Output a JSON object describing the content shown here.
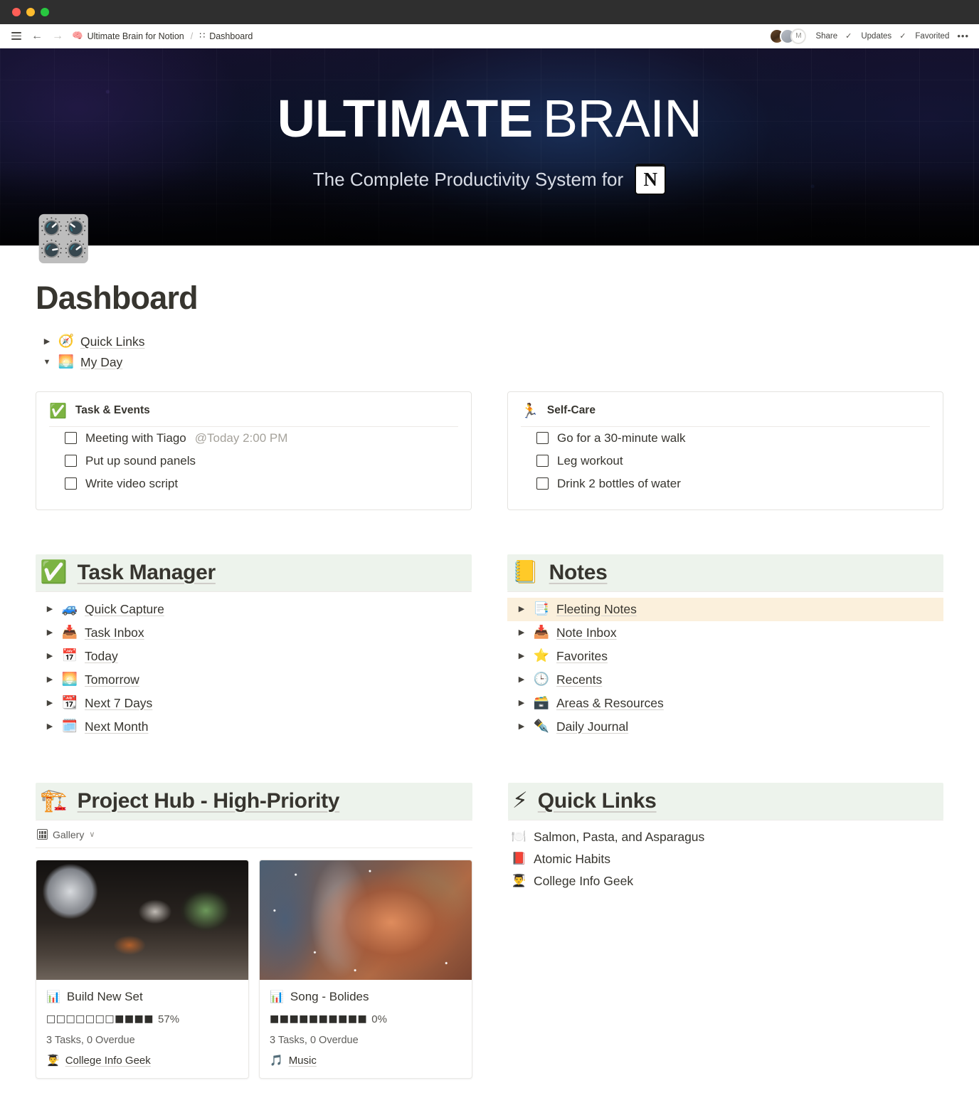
{
  "window": {
    "traffic_lights": [
      "close",
      "minimize",
      "maximize"
    ]
  },
  "topbar": {
    "menu_icon": "hamburger-icon",
    "back_icon": "arrow-left-icon",
    "forward_icon": "arrow-right-icon",
    "breadcrumb": {
      "parent_emoji": "🧠",
      "parent": "Ultimate Brain for Notion",
      "separator": "/",
      "current_emoji": "∷",
      "current": "Dashboard"
    },
    "avatars": [
      {
        "name": "avatar-1",
        "initial": ""
      },
      {
        "name": "avatar-2",
        "initial": ""
      },
      {
        "name": "avatar-3",
        "initial": "M"
      }
    ],
    "share_label": "Share",
    "updates_label": "Updates",
    "favorited_label": "Favorited",
    "check_glyph": "✓",
    "more_label": "•••"
  },
  "hero": {
    "title_bold": "ULTIMATE",
    "title_light": "BRAIN",
    "subtitle": "The Complete Productivity System for",
    "notion_logo_letter": "N"
  },
  "page": {
    "icon": "🎛️",
    "title": "Dashboard"
  },
  "toggles": [
    {
      "triangle": "▶",
      "emoji": "🧭",
      "label": "Quick Links"
    },
    {
      "triangle": "▼",
      "emoji": "🌅",
      "label": "My Day"
    }
  ],
  "my_day": {
    "tasks_card": {
      "emoji": "✅",
      "title": "Task & Events",
      "items": [
        {
          "text": "Meeting with Tiago ",
          "mention": "@Today 2:00 PM"
        },
        {
          "text": "Put up sound panels",
          "mention": ""
        },
        {
          "text": "Write video script",
          "mention": ""
        }
      ]
    },
    "selfcare_card": {
      "emoji": "🏃",
      "title": "Self-Care",
      "items": [
        {
          "text": "Go for a 30-minute walk",
          "mention": ""
        },
        {
          "text": "Leg workout",
          "mention": ""
        },
        {
          "text": "Drink 2 bottles of water",
          "mention": ""
        }
      ]
    }
  },
  "task_manager": {
    "emoji": "✅",
    "title": "Task Manager",
    "items": [
      {
        "triangle": "▶",
        "emoji": "🚙",
        "label": "Quick Capture",
        "highlight": false
      },
      {
        "triangle": "▶",
        "emoji": "📥",
        "label": "Task Inbox",
        "highlight": false
      },
      {
        "triangle": "▶",
        "emoji": "📅",
        "label": "Today",
        "highlight": false
      },
      {
        "triangle": "▶",
        "emoji": "🌅",
        "label": "Tomorrow",
        "highlight": false
      },
      {
        "triangle": "▶",
        "emoji": "📆",
        "label": "Next 7 Days",
        "highlight": false
      },
      {
        "triangle": "▶",
        "emoji": "🗓️",
        "label": "Next Month",
        "highlight": false
      }
    ]
  },
  "notes": {
    "emoji": "📒",
    "title": "Notes",
    "items": [
      {
        "triangle": "▶",
        "emoji": "📑",
        "label": "Fleeting Notes",
        "highlight": true
      },
      {
        "triangle": "▶",
        "emoji": "📥",
        "label": "Note Inbox",
        "highlight": false
      },
      {
        "triangle": "▶",
        "emoji": "⭐",
        "label": "Favorites",
        "highlight": false
      },
      {
        "triangle": "▶",
        "emoji": "🕒",
        "label": "Recents",
        "highlight": false
      },
      {
        "triangle": "▶",
        "emoji": "🗃️",
        "label": "Areas & Resources",
        "highlight": false
      },
      {
        "triangle": "▶",
        "emoji": "✒️",
        "label": "Daily Journal",
        "highlight": false
      }
    ]
  },
  "project_hub": {
    "emoji": "🏗️",
    "title": "Project Hub - High-Priority",
    "view_label": "Gallery",
    "view_icon": "grid-icon",
    "chevron": "∨",
    "cards": [
      {
        "image": "studio",
        "emoji": "📊",
        "title": "Build New Set",
        "progress_bar": "□□□□□□□■■■■",
        "progress_pct": "57%",
        "meta": "3 Tasks, 0 Overdue",
        "tag_emoji": "👨‍🎓",
        "tag": "College Info Geek"
      },
      {
        "image": "nebula",
        "emoji": "📊",
        "title": "Song - Bolides",
        "progress_bar": "■■■■■■■■■■",
        "progress_pct": "0%",
        "meta": "3 Tasks, 0 Overdue",
        "tag_emoji": "🎵",
        "tag": "Music"
      }
    ]
  },
  "quick_links": {
    "emoji": "⚡",
    "title": "Quick Links",
    "items": [
      {
        "emoji": "🍽️",
        "label": "Salmon, Pasta, and Asparagus"
      },
      {
        "emoji": "📕",
        "label": "Atomic Habits"
      },
      {
        "emoji": "👨‍🎓",
        "label": "College Info Geek"
      }
    ]
  }
}
